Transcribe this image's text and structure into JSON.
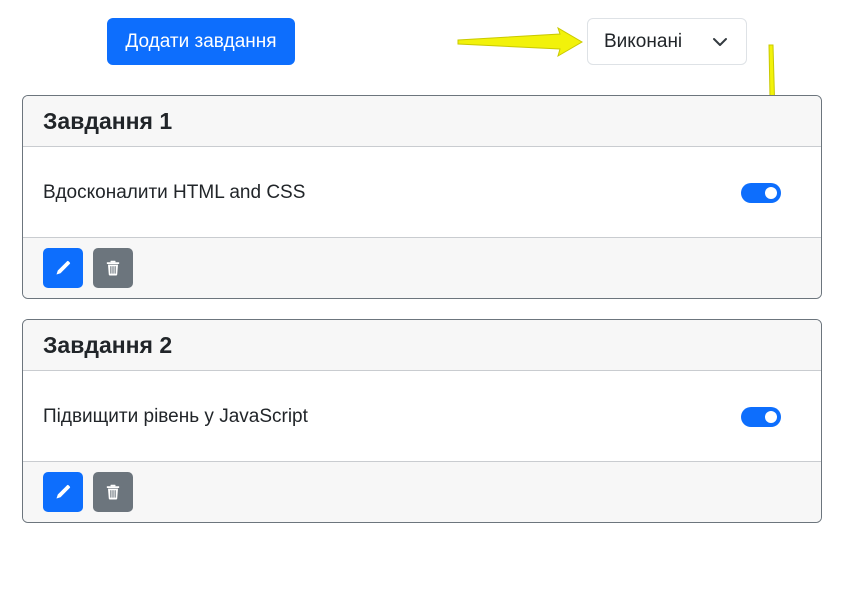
{
  "toolbar": {
    "add_button_label": "Додати завдання",
    "filter_selected": "Виконані"
  },
  "tasks": [
    {
      "title": "Завдання 1",
      "text": "Вдосконалити HTML and CSS",
      "completed": true
    },
    {
      "title": "Завдання 2",
      "text": "Підвищити рівень у JavaScript",
      "completed": true
    }
  ],
  "colors": {
    "primary": "#0d6efd",
    "secondary": "#6c757d",
    "annotation_arrow": "#f2f20a"
  },
  "icons": {
    "edit": "pencil-icon",
    "delete": "trash-icon",
    "dropdown": "chevron-down-icon",
    "annotation": "arrow-annotation"
  }
}
